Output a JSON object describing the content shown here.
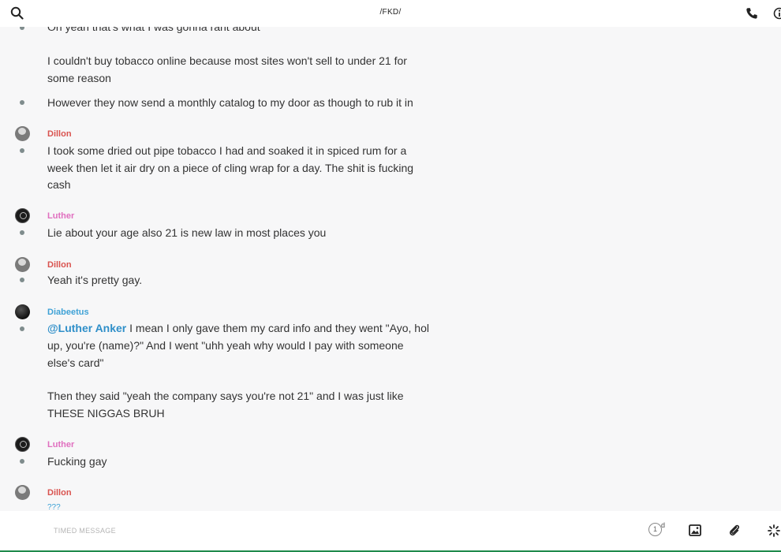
{
  "header": {
    "title": "/FKD/",
    "icons": [
      "search-icon",
      "phone-icon",
      "info-icon"
    ]
  },
  "colors": {
    "dillon": "#d9534f",
    "luther": "#e06fbf",
    "diabeetus": "#3fa2d6",
    "mention": "#2f8fc9"
  },
  "messages": {
    "m0": {
      "line1": "Oh yeah that's what I was gonna rant about"
    },
    "m1": {
      "line1": "I couldn't buy tobacco online because most sites won't sell to under 21 for",
      "line2": "some reason"
    },
    "m2": {
      "line1": "However they now send a monthly catalog to my door as though to rub it in"
    },
    "m3": {
      "author": "Dillon",
      "line1": "I took some dried out pipe tobacco I had and soaked it in spiced rum for a",
      "line2": "week then let it air dry on a piece of cling wrap for a day. The shit is fucking",
      "line3": "cash"
    },
    "m4": {
      "author": "Luther",
      "line1": "Lie about your age also 21 is new law in most places you"
    },
    "m5": {
      "author": "Dillon",
      "line1": "Yeah it's pretty gay."
    },
    "m6": {
      "author": "Diabeetus",
      "mention": "@Luther Anker",
      "line1_rest": " I mean I only gave them my card info and they went \"Ayo, hol",
      "line2": "up, you're (name)?\" And I went \"uhh yeah why would I pay with someone",
      "line3": "else's card\""
    },
    "m7": {
      "line1": "Then they said \"yeah the company says you're not 21\" and I was just like",
      "line2": "THESE NIGGAS BRUH"
    },
    "m8": {
      "author": "Luther",
      "line1": "Fucking gay"
    },
    "m9": {
      "author": "Dillon",
      "line1": "???"
    }
  },
  "composer": {
    "placeholder": "TIMED MESSAGE",
    "timer_value": "1",
    "timer_unit": "d",
    "icons": [
      "timer-icon",
      "image-icon",
      "paperclip-icon",
      "loading-icon"
    ]
  }
}
